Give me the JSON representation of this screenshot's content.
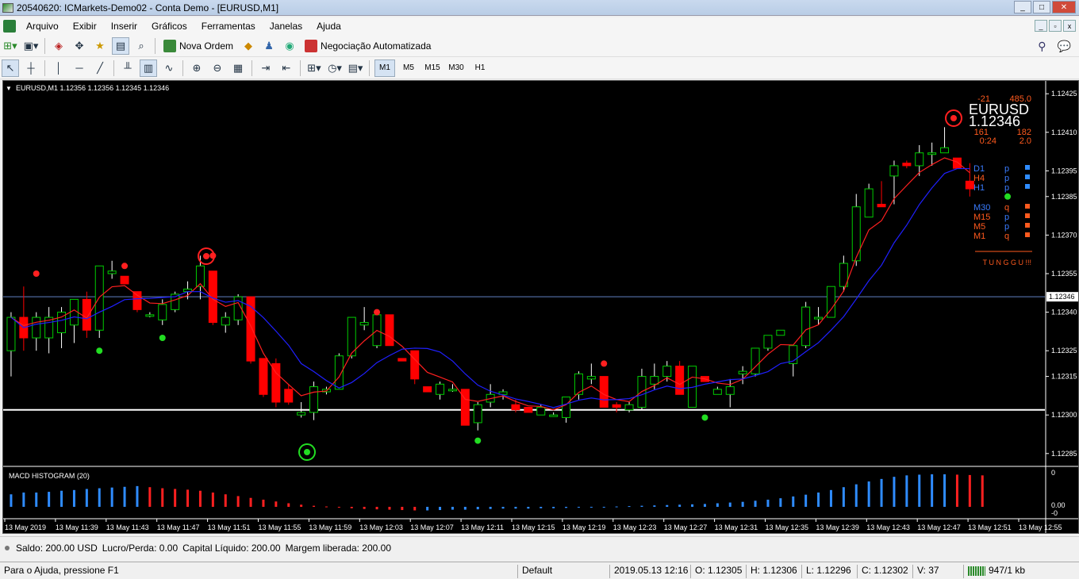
{
  "window": {
    "title": "20540620: ICMarkets-Demo02 - Conta Demo - [EURUSD,M1]",
    "buttons": [
      "_",
      "□",
      "✕"
    ]
  },
  "menu": [
    "Arquivo",
    "Exibir",
    "Inserir",
    "Gráficos",
    "Ferramentas",
    "Janelas",
    "Ajuda"
  ],
  "toolbar1": {
    "new_order_label": "Nova Ordem",
    "auto_trading_label": "Negociação Automatizada"
  },
  "toolbar2": {
    "timeframes": [
      "M1",
      "M5",
      "M15",
      "M30",
      "H1"
    ],
    "selected_timeframe": "M1"
  },
  "chart": {
    "header": "EURUSD,M1  1.12356 1.12356 1.12345 1.12346",
    "price_axis": [
      "1.12425",
      "1.12410",
      "1.12395",
      "1.12385",
      "1.12370",
      "1.12355",
      "1.12340",
      "1.12325",
      "1.12315",
      "1.12300",
      "1.12285"
    ],
    "current_price_label": "1.12346",
    "time_axis": [
      "13 May 2019",
      "13 May 11:39",
      "13 May 11:43",
      "13 May 11:47",
      "13 May 11:51",
      "13 May 11:55",
      "13 May 11:59",
      "13 May 12:03",
      "13 May 12:07",
      "13 May 12:11",
      "13 May 12:15",
      "13 May 12:19",
      "13 May 12:23",
      "13 May 12:27",
      "13 May 12:31",
      "13 May 12:35",
      "13 May 12:39",
      "13 May 12:43",
      "13 May 12:47",
      "13 May 12:51",
      "13 May 12:55"
    ],
    "info_panel": {
      "spread": "-21",
      "value": "485.0",
      "symbol": "EURUSD",
      "price": "1.12346",
      "left_small": "161",
      "right_small": "182",
      "timer": "0:24",
      "ratio": "2.0",
      "timeframes": [
        {
          "tf": "D1",
          "sig": "p",
          "color": "#3a7cff"
        },
        {
          "tf": "H4",
          "sig": "p",
          "color": "#ff5a1e"
        },
        {
          "tf": "H1",
          "sig": "p",
          "color": "#3a7cff"
        },
        {
          "tf": "M30",
          "sig": "q",
          "color": "#3a7cff"
        },
        {
          "tf": "M15",
          "sig": "p",
          "color": "#ff5a1e"
        },
        {
          "tf": "M5",
          "sig": "p",
          "color": "#ff5a1e"
        },
        {
          "tf": "M1",
          "sig": "q",
          "color": "#ff5a1e"
        }
      ],
      "status": "T U N G G U !!!"
    },
    "macd_label": "MACD HISTOGRAM (20)",
    "macd_axis": [
      "0",
      "0.00",
      "-0"
    ]
  },
  "chart_data": {
    "type": "candlestick",
    "symbol": "EURUSD",
    "timeframe": "M1",
    "ylim": [
      1.1228,
      1.1243
    ],
    "candles": [
      [
        1.12325,
        1.1234,
        1.12315,
        1.12338
      ],
      [
        1.12338,
        1.1235,
        1.12325,
        1.1233
      ],
      [
        1.1233,
        1.1234,
        1.12325,
        1.12338
      ],
      [
        1.1233,
        1.12342,
        1.12324,
        1.12338
      ],
      [
        1.12332,
        1.12342,
        1.12326,
        1.1234
      ],
      [
        1.12335,
        1.12345,
        1.12328,
        1.12345
      ],
      [
        1.12345,
        1.12348,
        1.1233,
        1.12333
      ],
      [
        1.12333,
        1.12358,
        1.1233,
        1.12358
      ],
      [
        1.12355,
        1.1236,
        1.12353,
        1.12356
      ],
      [
        1.12354,
        1.12354,
        1.12351,
        1.12351
      ],
      [
        1.12348,
        1.12348,
        1.1234,
        1.12341
      ],
      [
        1.12339,
        1.1234,
        1.12338,
        1.12339
      ],
      [
        1.12337,
        1.12345,
        1.12335,
        1.12343
      ],
      [
        1.12341,
        1.12348,
        1.1234,
        1.12347
      ],
      [
        1.12348,
        1.12352,
        1.12345,
        1.12349
      ],
      [
        1.1235,
        1.12362,
        1.12345,
        1.12358
      ],
      [
        1.12356,
        1.12356,
        1.12335,
        1.12336
      ],
      [
        1.12335,
        1.1234,
        1.12332,
        1.12338
      ],
      [
        1.12337,
        1.12347,
        1.12335,
        1.12346
      ],
      [
        1.12346,
        1.12346,
        1.1232,
        1.12321
      ],
      [
        1.12322,
        1.12322,
        1.12307,
        1.12308
      ],
      [
        1.1232,
        1.12322,
        1.12303,
        1.12305
      ],
      [
        1.1231,
        1.12312,
        1.12304,
        1.12305
      ],
      [
        1.123,
        1.12305,
        1.12299,
        1.12301
      ],
      [
        1.12301,
        1.12313,
        1.12298,
        1.12311
      ],
      [
        1.12309,
        1.12311,
        1.12308,
        1.1231
      ],
      [
        1.1231,
        1.12324,
        1.1231,
        1.12323
      ],
      [
        1.12323,
        1.12338,
        1.12322,
        1.12338
      ],
      [
        1.12335,
        1.12342,
        1.12333,
        1.12336
      ],
      [
        1.12327,
        1.1234,
        1.12326,
        1.12339
      ],
      [
        1.12339,
        1.12339,
        1.12327,
        1.12327
      ],
      [
        1.12322,
        1.12322,
        1.12321,
        1.12321
      ],
      [
        1.12325,
        1.12325,
        1.12312,
        1.12314
      ],
      [
        1.12311,
        1.12311,
        1.12309,
        1.12309
      ],
      [
        1.12308,
        1.12313,
        1.12306,
        1.12312
      ],
      [
        1.1231,
        1.12312,
        1.12309,
        1.1231
      ],
      [
        1.1231,
        1.1231,
        1.12296,
        1.12296
      ],
      [
        1.12297,
        1.12305,
        1.12294,
        1.12304
      ],
      [
        1.12305,
        1.12312,
        1.12303,
        1.12308
      ],
      [
        1.12308,
        1.1231,
        1.12306,
        1.12309
      ],
      [
        1.12304,
        1.12306,
        1.12301,
        1.12302
      ],
      [
        1.12303,
        1.12303,
        1.12301,
        1.12301
      ],
      [
        1.123,
        1.12304,
        1.123,
        1.12303
      ],
      [
        1.123,
        1.12301,
        1.123,
        1.123
      ],
      [
        1.12299,
        1.12307,
        1.12297,
        1.12307
      ],
      [
        1.12308,
        1.12317,
        1.12306,
        1.12316
      ],
      [
        1.12314,
        1.1232,
        1.12312,
        1.12315
      ],
      [
        1.12315,
        1.12315,
        1.12303,
        1.12303
      ],
      [
        1.12304,
        1.12305,
        1.12301,
        1.12303
      ],
      [
        1.12302,
        1.12305,
        1.12301,
        1.12304
      ],
      [
        1.12303,
        1.12318,
        1.12302,
        1.12315
      ],
      [
        1.12312,
        1.1232,
        1.1231,
        1.12315
      ],
      [
        1.12315,
        1.12321,
        1.12313,
        1.12319
      ],
      [
        1.12319,
        1.12321,
        1.12308,
        1.12308
      ],
      [
        1.12303,
        1.12319,
        1.12303,
        1.12319
      ],
      [
        1.12315,
        1.12315,
        1.12313,
        1.12313
      ],
      [
        1.12308,
        1.12311,
        1.12308,
        1.1231
      ],
      [
        1.12308,
        1.12314,
        1.12303,
        1.12311
      ],
      [
        1.12316,
        1.12319,
        1.12312,
        1.12317
      ],
      [
        1.12316,
        1.12326,
        1.12315,
        1.12326
      ],
      [
        1.12326,
        1.12331,
        1.12325,
        1.12331
      ],
      [
        1.12331,
        1.12333,
        1.12331,
        1.12333
      ],
      [
        1.1232,
        1.12327,
        1.12315,
        1.12327
      ],
      [
        1.12327,
        1.12344,
        1.12326,
        1.12342
      ],
      [
        1.12338,
        1.12342,
        1.12335,
        1.12338
      ],
      [
        1.12338,
        1.12348,
        1.12338,
        1.1235
      ],
      [
        1.1235,
        1.12362,
        1.12348,
        1.12359
      ],
      [
        1.1236,
        1.12386,
        1.12358,
        1.12381
      ],
      [
        1.12377,
        1.1239,
        1.12377,
        1.12388
      ],
      [
        1.12382,
        1.12391,
        1.12381,
        1.12381
      ],
      [
        1.12393,
        1.12399,
        1.12382,
        1.12397
      ],
      [
        1.12398,
        1.12399,
        1.12396,
        1.12397
      ],
      [
        1.12397,
        1.12405,
        1.12393,
        1.12402
      ],
      [
        1.12402,
        1.12406,
        1.12397,
        1.12402
      ],
      [
        1.12402,
        1.12412,
        1.12402,
        1.12404
      ],
      [
        1.124,
        1.124,
        1.12396,
        1.12396
      ],
      [
        1.12391,
        1.12398,
        1.12385,
        1.12388
      ]
    ],
    "moving_averages": [
      {
        "name": "red",
        "color": "#ff2020"
      },
      {
        "name": "blue",
        "color": "#2020ff"
      }
    ],
    "horizontal_lines": [
      {
        "price": 1.12346,
        "color": "#6080c0"
      },
      {
        "price": 1.12302,
        "color": "#ffffff"
      }
    ],
    "macd_histogram": [
      0.35,
      0.4,
      0.4,
      0.42,
      0.45,
      0.47,
      0.5,
      0.52,
      0.54,
      0.56,
      0.58,
      0.55,
      0.52,
      0.5,
      0.48,
      0.45,
      0.4,
      0.35,
      0.3,
      0.25,
      0.2,
      0.15,
      0.1,
      0.06,
      0.03,
      0.01,
      -0.02,
      -0.04,
      -0.06,
      -0.07,
      -0.08,
      -0.09,
      -0.1,
      -0.1,
      -0.09,
      -0.08,
      -0.08,
      -0.07,
      -0.06,
      -0.05,
      -0.05,
      -0.05,
      -0.04,
      -0.04,
      -0.03,
      -0.02,
      -0.01,
      0.0,
      0.01,
      0.02,
      0.03,
      0.04,
      0.05,
      0.06,
      0.07,
      0.08,
      0.1,
      0.12,
      0.14,
      0.17,
      0.2,
      0.24,
      0.29,
      0.34,
      0.4,
      0.47,
      0.55,
      0.63,
      0.71,
      0.78,
      0.84,
      0.88,
      0.9,
      0.91,
      0.91,
      0.9,
      0.89,
      0.88
    ]
  },
  "account_bar": {
    "balance": "Saldo: 200.00 USD",
    "profit": "Lucro/Perda: 0.00",
    "equity": "Capital Líquido: 200.00",
    "free_margin": "Margem liberada: 200.00"
  },
  "statusbar": {
    "help": "Para o Ajuda, pressione F1",
    "profile": "Default",
    "datetime": "2019.05.13 12:16",
    "open": "O: 1.12305",
    "high": "H: 1.12306",
    "low": "L: 1.12296",
    "close": "C: 1.12302",
    "volume": "V: 37",
    "traffic": "947/1 kb"
  }
}
